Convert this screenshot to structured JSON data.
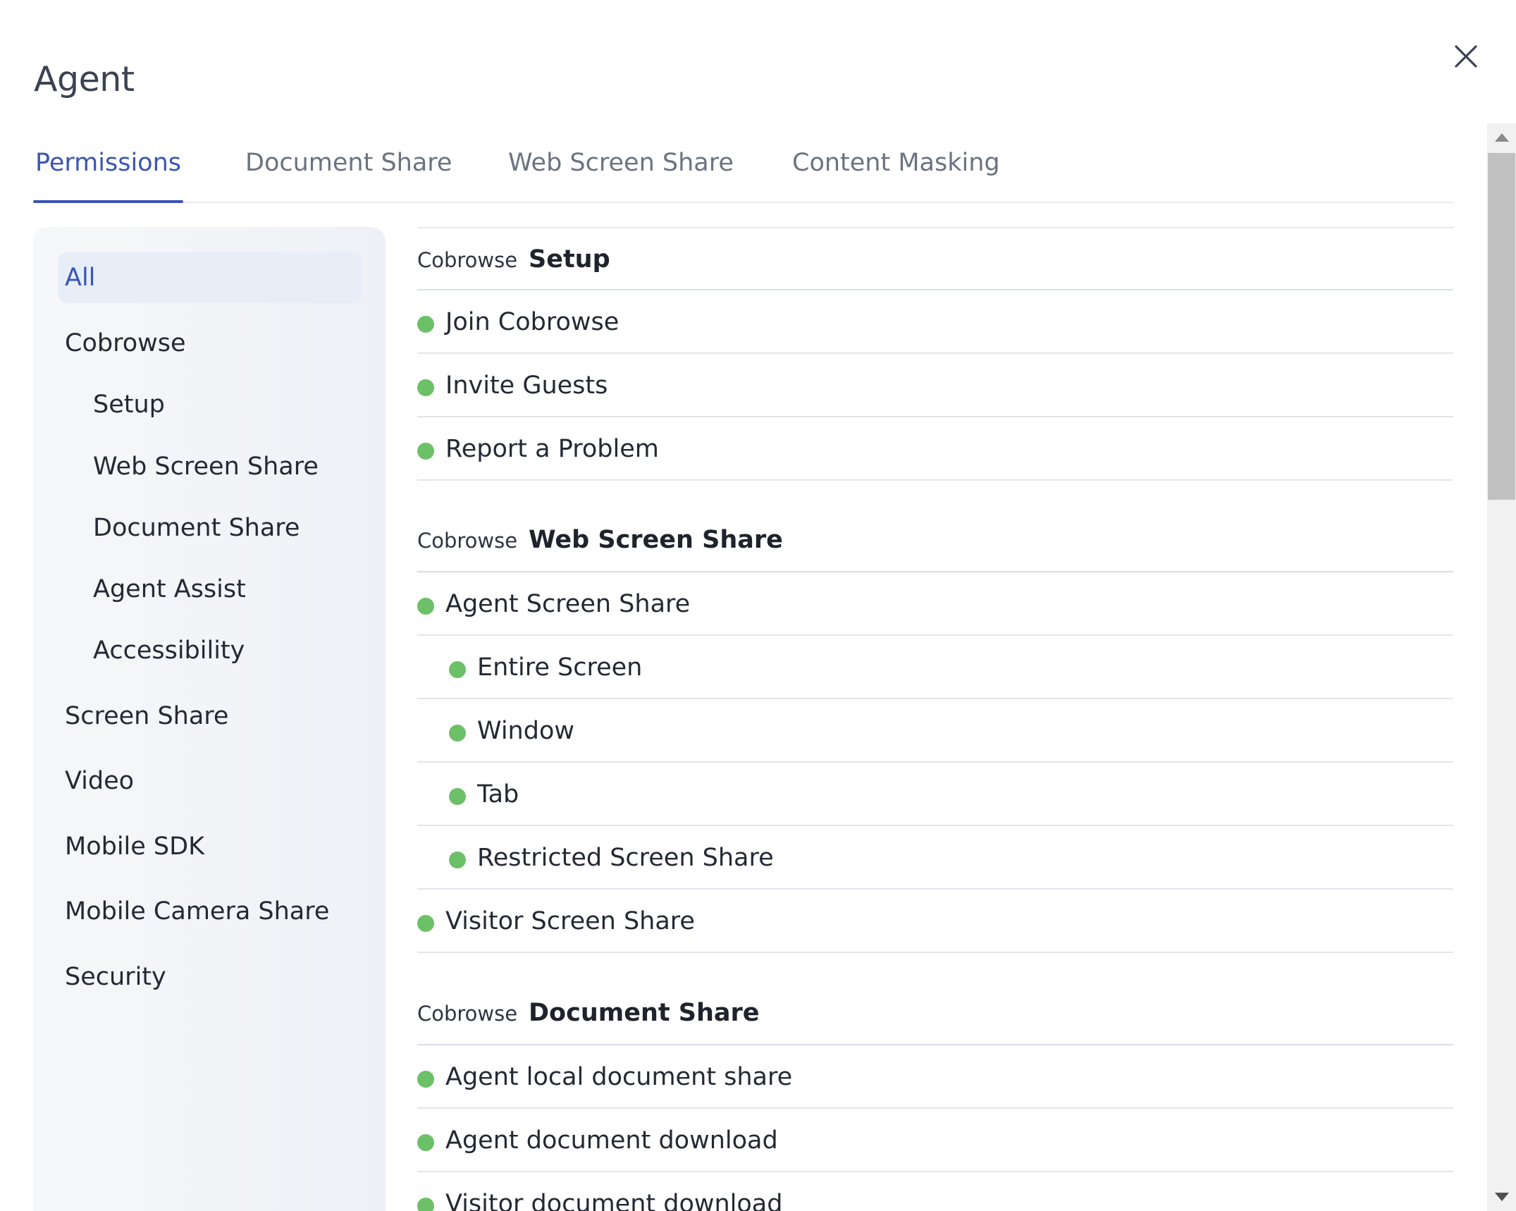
{
  "dialog": {
    "title": "Agent"
  },
  "tabs": [
    {
      "label": "Permissions",
      "active": true
    },
    {
      "label": "Document Share",
      "active": false
    },
    {
      "label": "Web Screen Share",
      "active": false
    },
    {
      "label": "Content Masking",
      "active": false
    }
  ],
  "sidebar": {
    "items": [
      {
        "label": "All",
        "selected": true
      },
      {
        "label": "Cobrowse"
      },
      {
        "label": "Setup"
      },
      {
        "label": "Web Screen Share"
      },
      {
        "label": "Document Share"
      },
      {
        "label": "Agent Assist"
      },
      {
        "label": "Accessibility"
      },
      {
        "label": "Screen Share"
      },
      {
        "label": "Video"
      },
      {
        "label": "Mobile SDK"
      },
      {
        "label": "Mobile Camera Share"
      },
      {
        "label": "Security"
      }
    ]
  },
  "sections": [
    {
      "prefix": "Cobrowse",
      "name": "Setup",
      "rows": [
        {
          "label": "Join Cobrowse",
          "status": "enabled"
        },
        {
          "label": "Invite Guests",
          "status": "enabled"
        },
        {
          "label": "Report a Problem",
          "status": "enabled"
        }
      ]
    },
    {
      "prefix": "Cobrowse",
      "name": "Web Screen Share",
      "rows": [
        {
          "label": "Agent Screen Share",
          "status": "enabled"
        },
        {
          "label": "Entire Screen",
          "status": "enabled"
        },
        {
          "label": "Window",
          "status": "enabled"
        },
        {
          "label": "Tab",
          "status": "enabled"
        },
        {
          "label": "Restricted Screen Share",
          "status": "enabled"
        },
        {
          "label": "Visitor Screen Share",
          "status": "enabled"
        }
      ]
    },
    {
      "prefix": "Cobrowse",
      "name": "Document Share",
      "rows": [
        {
          "label": "Agent local document share",
          "status": "enabled"
        },
        {
          "label": "Agent document download",
          "status": "enabled"
        },
        {
          "label": "Visitor document download",
          "status": "enabled"
        }
      ]
    }
  ],
  "colors": {
    "accent": "#3a55b4",
    "enabled_dot": "#6cc067",
    "sidebar_selected_bg": "#e8eef8"
  },
  "icons": {
    "close": "close-icon"
  }
}
